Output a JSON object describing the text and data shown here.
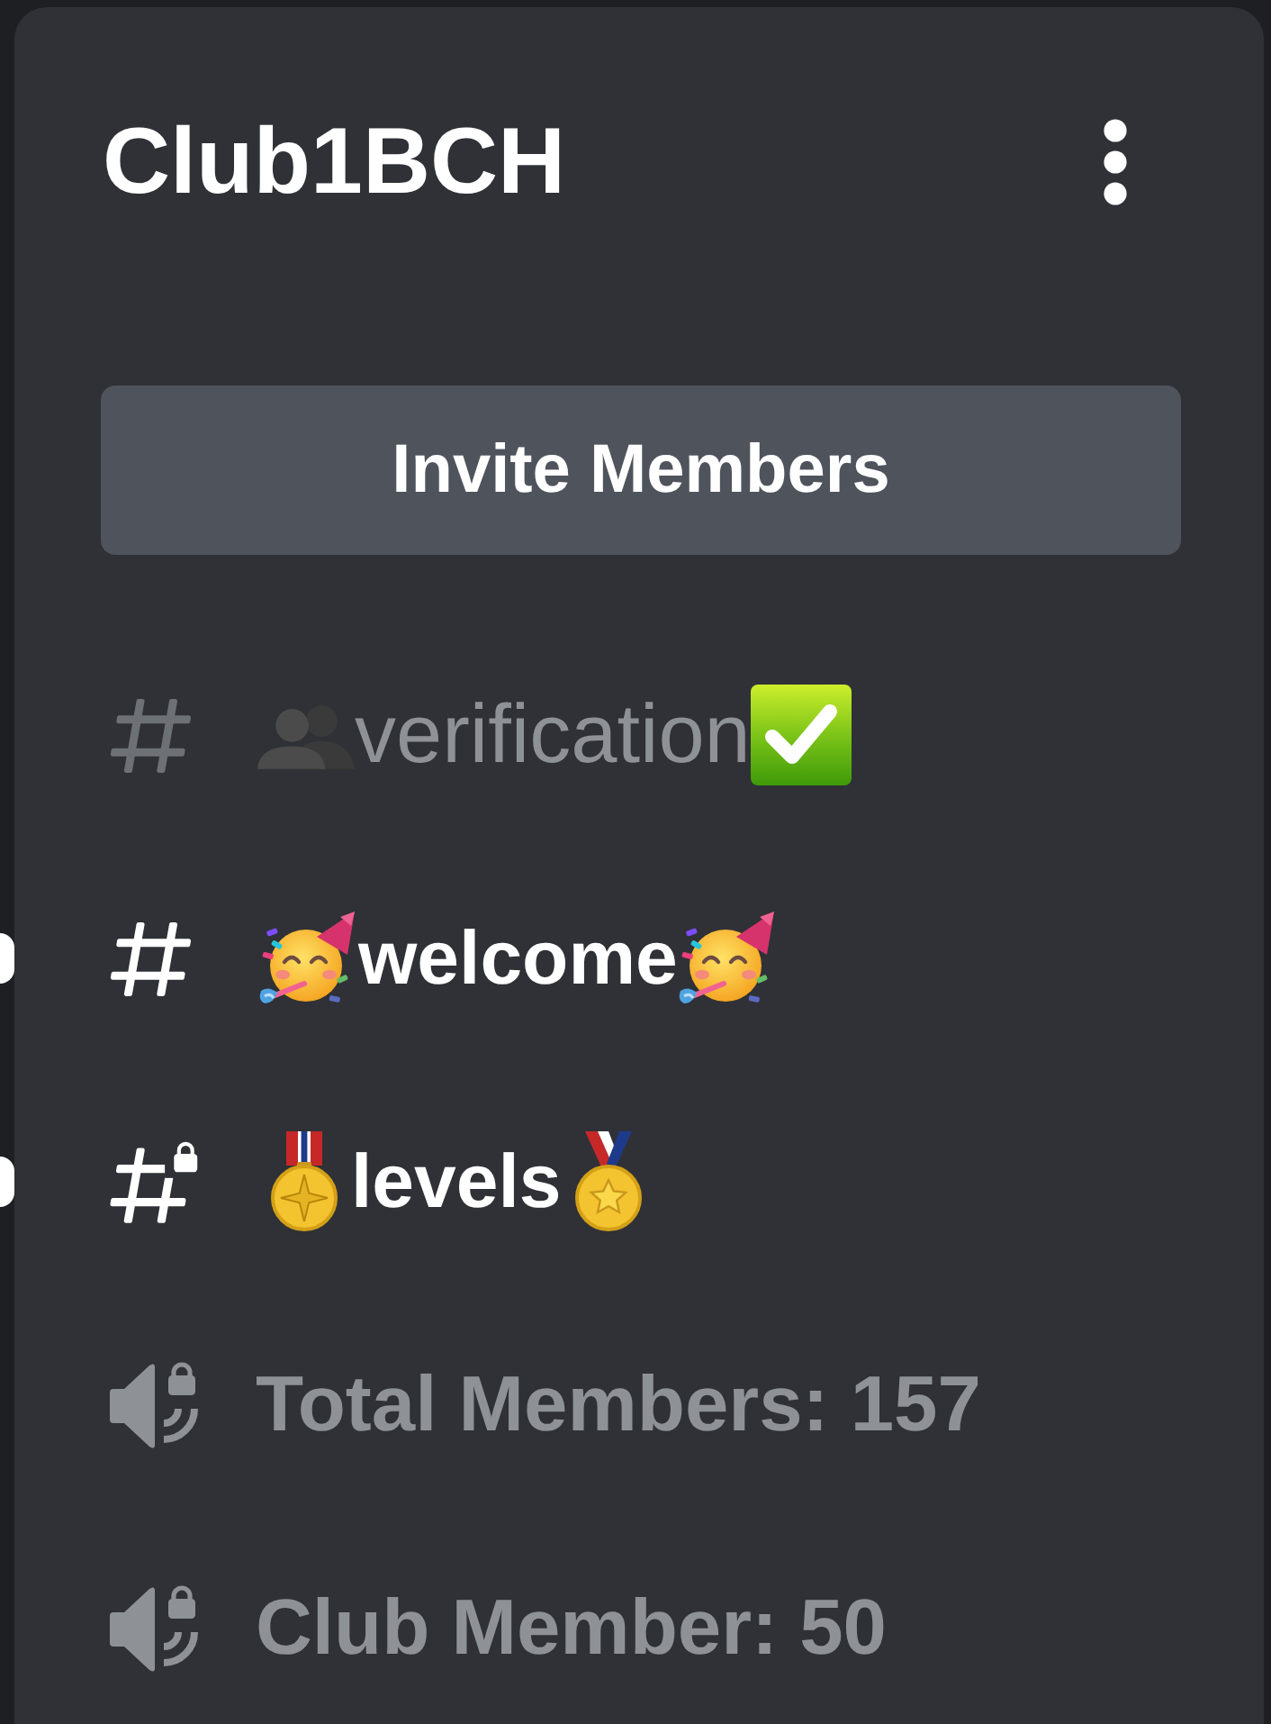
{
  "server": {
    "name": "Club1BCH"
  },
  "invite_button": {
    "label": "Invite Members"
  },
  "channels": [
    {
      "kind": "text",
      "name": "verification",
      "unread": false,
      "lead_emoji": {
        "kind": "busts"
      },
      "trail_emoji": {
        "kind": "check"
      }
    },
    {
      "kind": "text",
      "name": "welcome",
      "unread": true,
      "lead_emoji": {
        "kind": "party"
      },
      "trail_emoji": {
        "kind": "party"
      }
    },
    {
      "kind": "locked-text",
      "name": "levels",
      "unread": true,
      "lead_emoji": {
        "kind": "military-medal"
      },
      "trail_emoji": {
        "kind": "sports-medal"
      }
    },
    {
      "kind": "locked-voice",
      "name": "Total Members: 157",
      "unread": false
    },
    {
      "kind": "locked-voice",
      "name": "Club Member: 50",
      "unread": false
    }
  ]
}
